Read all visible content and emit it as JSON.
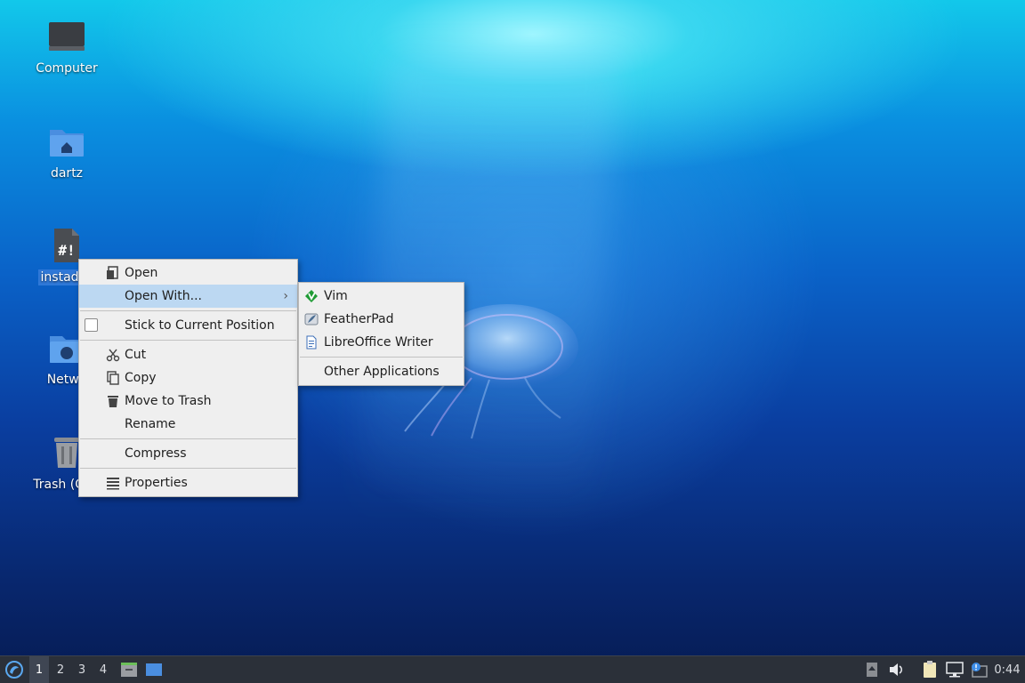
{
  "desktop": {
    "icons": [
      {
        "label": "Computer"
      },
      {
        "label": "dartz"
      },
      {
        "label": "instades"
      },
      {
        "label": "Netwo"
      },
      {
        "label": "Trash (One"
      }
    ]
  },
  "context_menu": {
    "items": {
      "open": "Open",
      "open_with": "Open With...",
      "stick": "Stick to Current Position",
      "cut": "Cut",
      "copy": "Copy",
      "move_to_trash": "Move to Trash",
      "rename": "Rename",
      "compress": "Compress",
      "properties": "Properties"
    },
    "open_with_arrow": "›"
  },
  "submenu": {
    "items": {
      "vim": "Vim",
      "featherpad": "FeatherPad",
      "libreoffice": "LibreOffice Writer",
      "other": "Other Applications"
    }
  },
  "taskbar": {
    "workspaces": [
      "1",
      "2",
      "3",
      "4"
    ],
    "active_workspace": "1",
    "clock": "0:44"
  },
  "colors": {
    "selection": "#2f78d8",
    "menu_highlight": "#bcd8f2",
    "taskbar": "#2b3039"
  }
}
